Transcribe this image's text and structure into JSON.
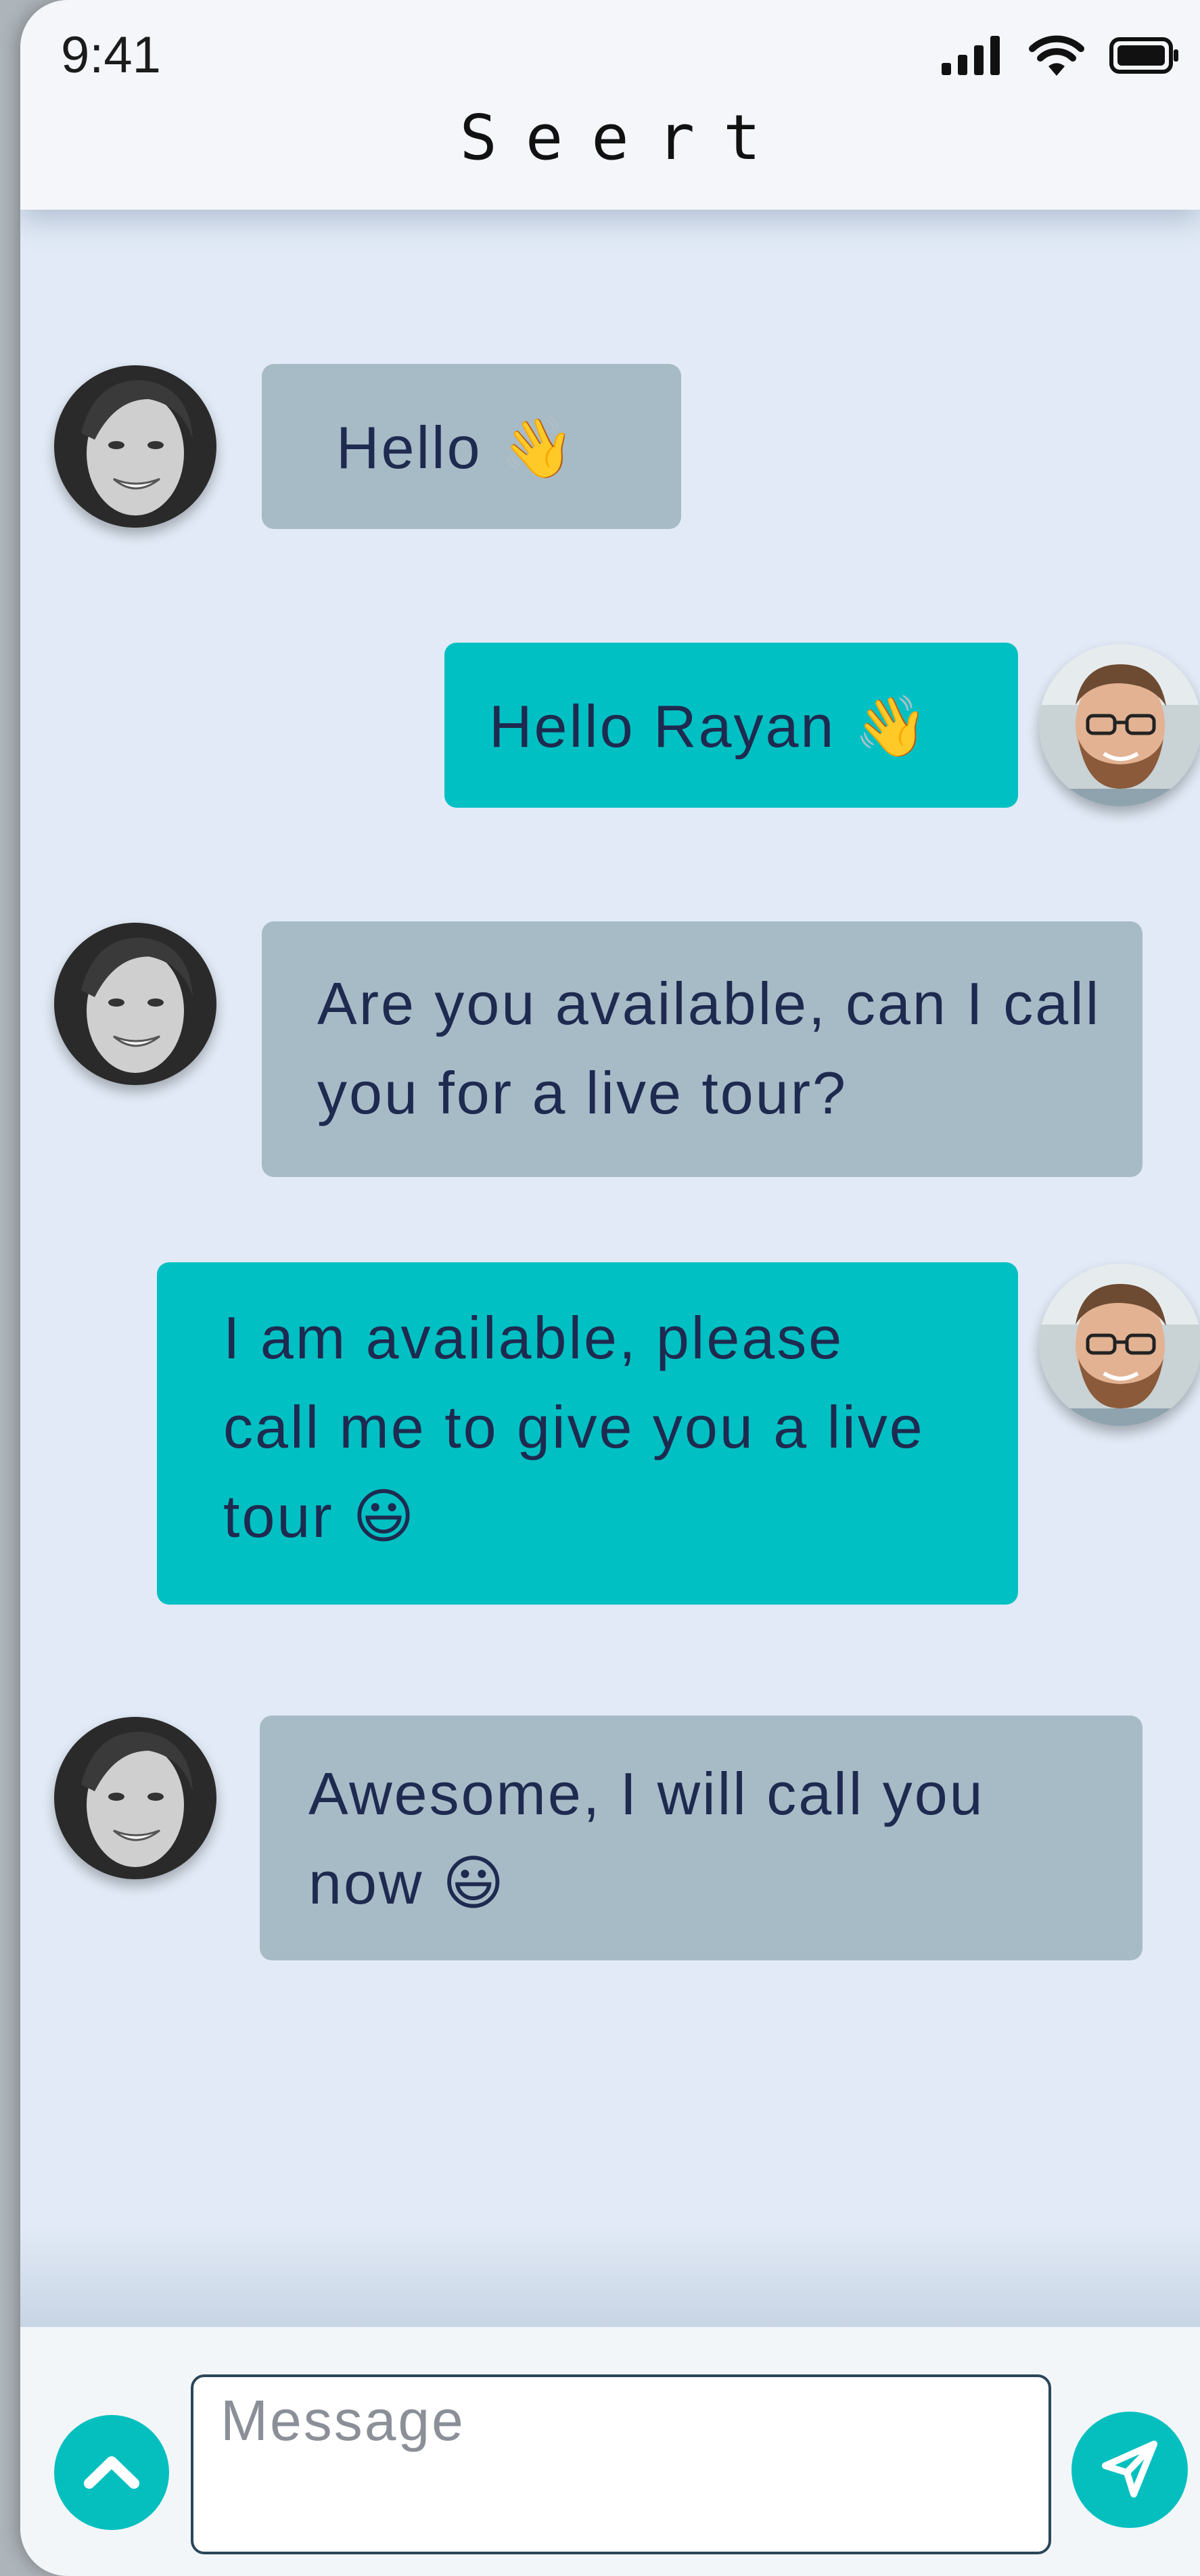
{
  "status_bar": {
    "time": "9:41",
    "icons": [
      "cellular-signal-icon",
      "wifi-icon",
      "battery-icon"
    ]
  },
  "header": {
    "title": "Seert"
  },
  "messages": [
    {
      "sender": "incoming",
      "avatar": "woman-avatar",
      "text": "Hello 👋"
    },
    {
      "sender": "outgoing",
      "avatar": "man-avatar",
      "text": "Hello Rayan 👋"
    },
    {
      "sender": "incoming",
      "avatar": "woman-avatar",
      "text": "Are you available, can I call you for a live tour?"
    },
    {
      "sender": "outgoing",
      "avatar": "man-avatar",
      "text": "I am available, please call me to give you a live tour 😃"
    },
    {
      "sender": "incoming",
      "avatar": "woman-avatar",
      "text": "Awesome, I will call you now 😃"
    }
  ],
  "composer": {
    "placeholder": "Message",
    "value": "",
    "expand_icon": "chevron-up-icon",
    "send_icon": "send-icon"
  },
  "colors": {
    "incoming_bubble": "#a7bbc7",
    "outgoing_bubble": "#00c0c3",
    "chat_background": "#e1eaf6",
    "text": "#1e2a4f",
    "accent": "#05bfbf"
  }
}
